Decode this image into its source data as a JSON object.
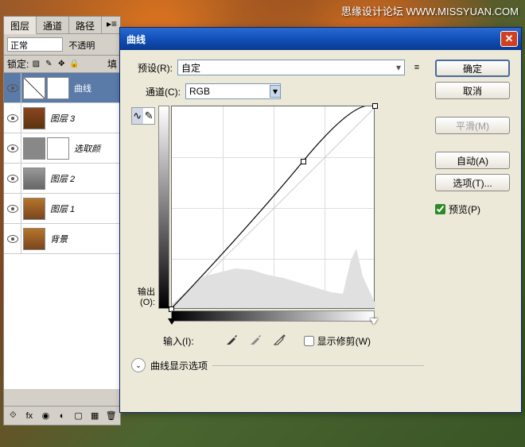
{
  "watermark": "思缘设计论坛  WWW.MISSYUAN.COM",
  "layers_panel": {
    "tabs": [
      "图层",
      "通道",
      "路径"
    ],
    "blend_mode": "正常",
    "opacity_label": "不透明",
    "lock_label": "锁定:",
    "fill_label": "填",
    "layers": [
      {
        "name": "曲线",
        "type": "adjustment",
        "selected": true
      },
      {
        "name": "图层 3",
        "type": "photo"
      },
      {
        "name": "选取颜",
        "type": "adjustment-mask"
      },
      {
        "name": "图层 2",
        "type": "photo"
      },
      {
        "name": "图层 1",
        "type": "photo"
      },
      {
        "name": "背景",
        "type": "bg"
      }
    ]
  },
  "curves_dialog": {
    "title": "曲线",
    "preset_label": "预设(R):",
    "preset_value": "自定",
    "channel_label": "通道(C):",
    "channel_value": "RGB",
    "output_label": "输出(O):",
    "input_label": "输入(I):",
    "show_clip_label": "显示修剪(W)",
    "expand_label": "曲线显示选项",
    "buttons": {
      "ok": "确定",
      "cancel": "取消",
      "smooth": "平滑(M)",
      "auto": "自动(A)",
      "options": "选项(T)...",
      "preview": "预览(P)"
    }
  },
  "chart_data": {
    "type": "line",
    "title": "曲线",
    "xlabel": "输入",
    "ylabel": "输出",
    "xlim": [
      0,
      255
    ],
    "ylim": [
      0,
      255
    ],
    "series": [
      {
        "name": "RGB curve",
        "points": [
          {
            "x": 0,
            "y": 0
          },
          {
            "x": 166,
            "y": 186
          },
          {
            "x": 255,
            "y": 255
          }
        ]
      }
    ],
    "grid": {
      "x_divisions": 4,
      "y_divisions": 4
    }
  }
}
